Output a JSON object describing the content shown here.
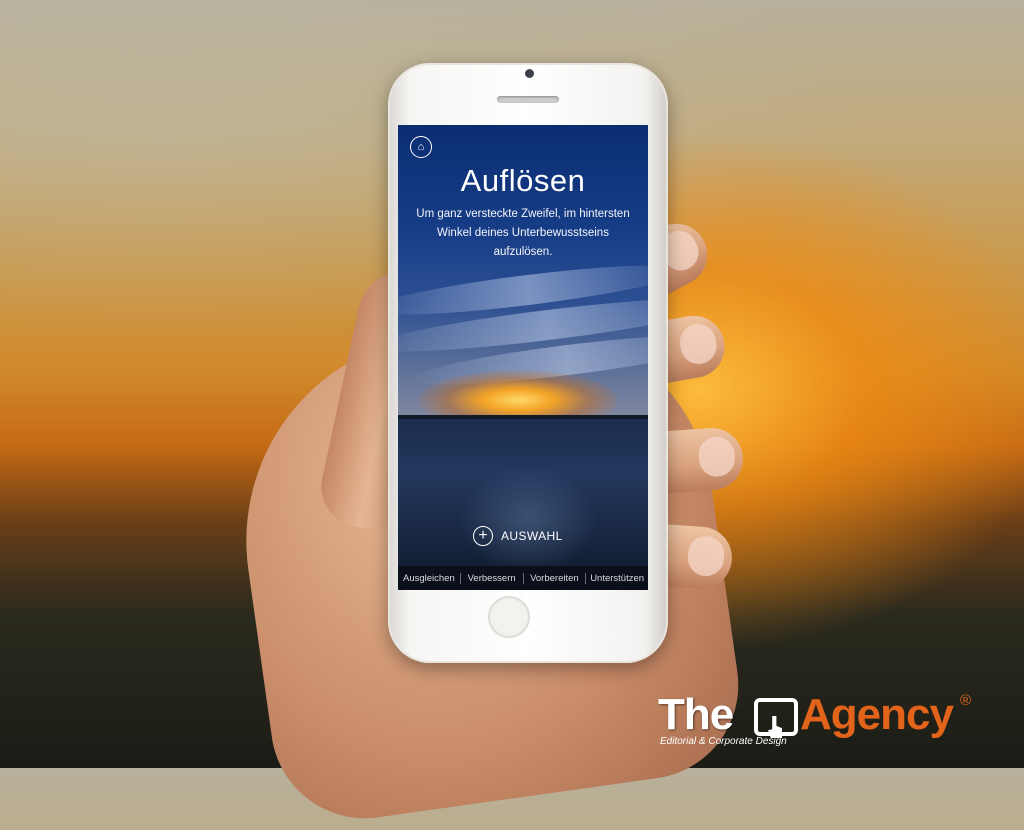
{
  "app": {
    "title": "Auflösen",
    "subtitle": "Um ganz versteckte Zweifel, im hintersten Winkel deines Unterbewusstseins aufzulösen.",
    "home_icon": "home-icon",
    "select_button_label": "AUSWAHL",
    "select_button_icon": "plus-circle-icon"
  },
  "bottom_nav": {
    "items": [
      {
        "label": "Ausgleichen"
      },
      {
        "label": "Verbessern"
      },
      {
        "label": "Vorbereiten"
      },
      {
        "label": "Unterstützen"
      }
    ]
  },
  "branding": {
    "logo_word_1": "The",
    "logo_word_2": "Agency",
    "logo_registered": "®",
    "logo_tagline": "Editorial & Corporate Design",
    "accent_color": "#e2641a"
  }
}
